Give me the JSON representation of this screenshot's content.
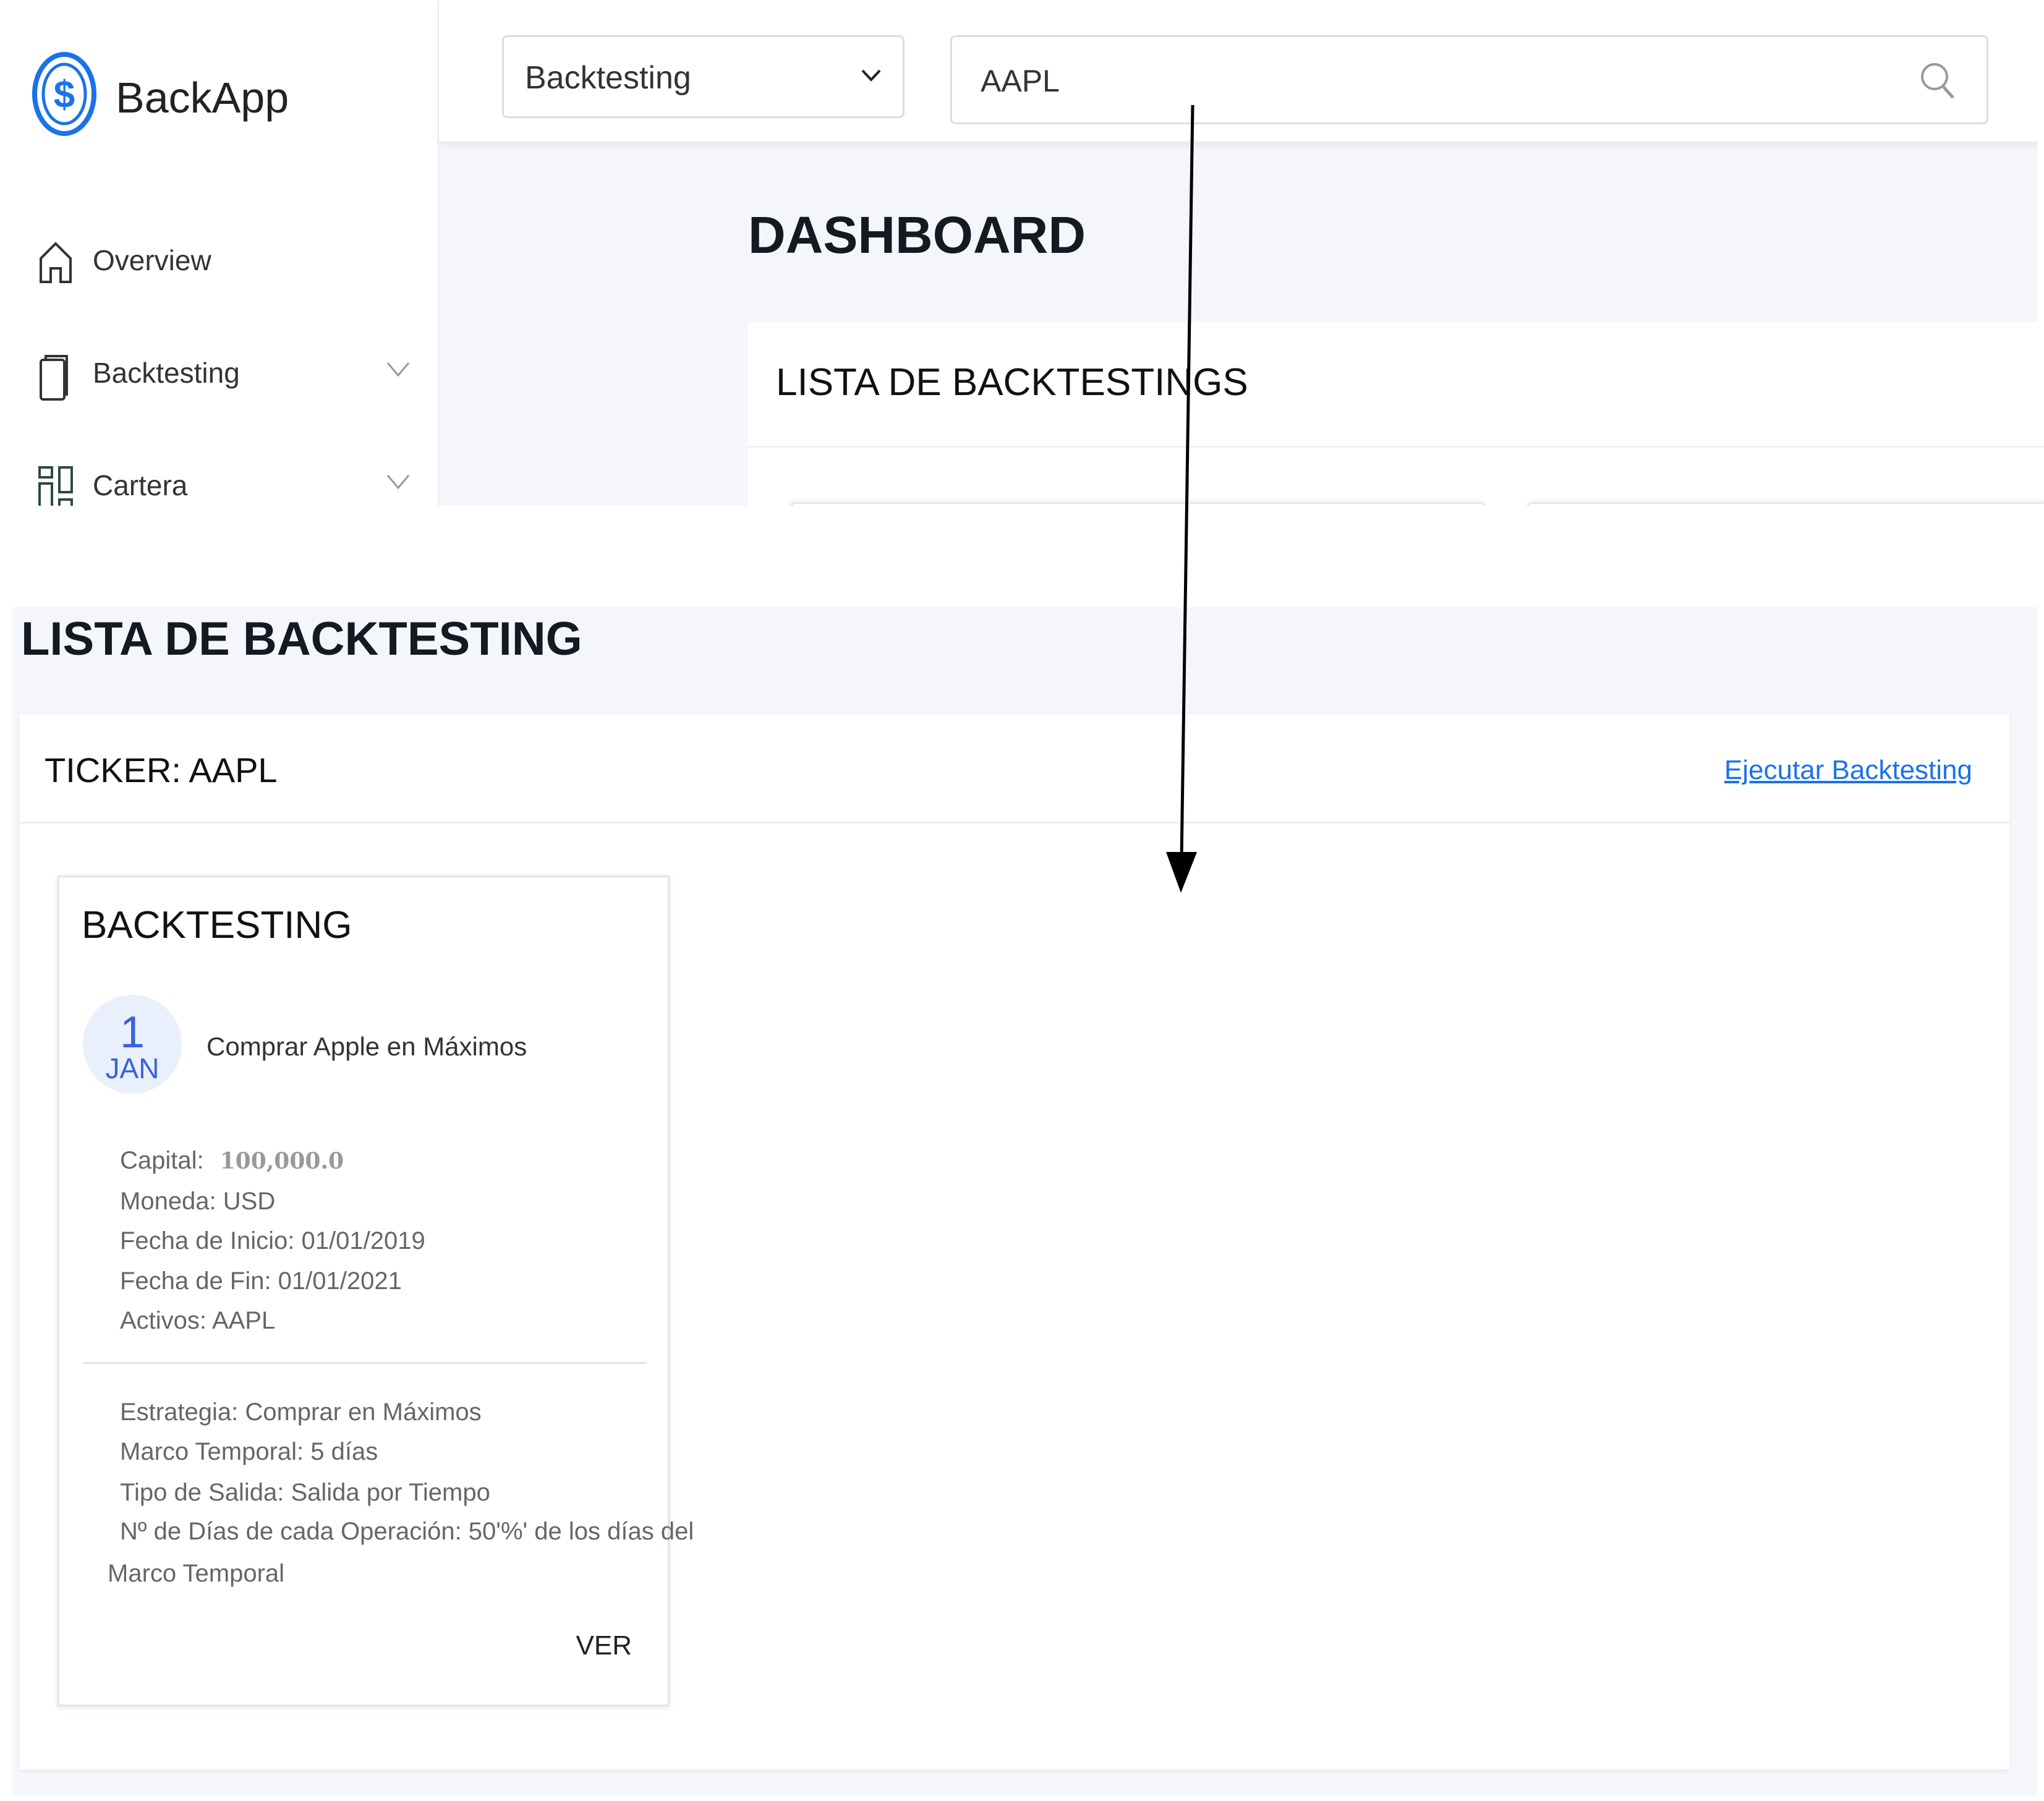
{
  "app": {
    "name": "BackApp",
    "accent": "#1a73e8"
  },
  "header": {
    "select_value": "Backtesting",
    "search_value": "AAPL"
  },
  "sidebar": {
    "items": [
      {
        "label": "Overview",
        "icon": "home-icon"
      },
      {
        "label": "Backtesting",
        "icon": "document-icon"
      },
      {
        "label": "Cartera",
        "icon": "grid-icon"
      }
    ]
  },
  "dashboard": {
    "title": "DASHBOARD",
    "panel_title": "LISTA DE BACKTESTINGS"
  },
  "list": {
    "title": "LISTA DE BACKTESTING",
    "ticker": "TICKER: AAPL",
    "run_link": "Ejecutar Backtesting",
    "card": {
      "title": "BACKTESTING",
      "day": "1",
      "month": "JAN",
      "name": "Comprar Apple en Máximos",
      "capital_label": "Capital:",
      "capital_value": "100,000.0",
      "details": [
        "Moneda: USD",
        "Fecha de Inicio: 01/01/2019",
        "Fecha de Fin: 01/01/2021",
        "Activos: AAPL"
      ],
      "strategy": [
        "Estrategia: Comprar en Máximos",
        "Marco Temporal: 5 días",
        "Tipo de Salida: Salida por Tiempo",
        "Nº de Días de cada Operación: 50'%' de los días del",
        "Marco Temporal"
      ],
      "view_label": "VER"
    }
  }
}
